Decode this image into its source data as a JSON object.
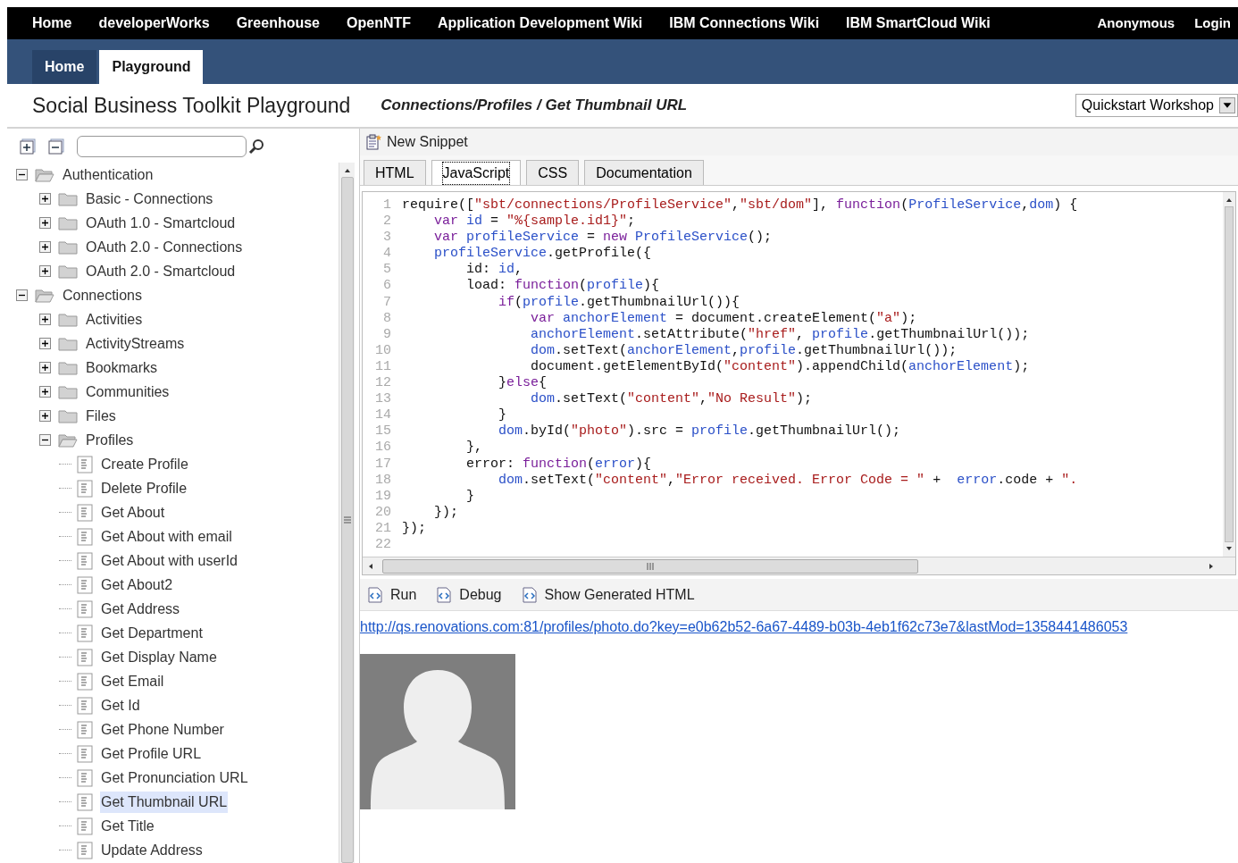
{
  "top_nav": {
    "links": [
      "Home",
      "developerWorks",
      "Greenhouse",
      "OpenNTF",
      "Application Development Wiki",
      "IBM Connections Wiki",
      "IBM SmartCloud Wiki"
    ],
    "user_links": [
      "Anonymous",
      "Login"
    ]
  },
  "main_tabs": [
    {
      "label": "Home",
      "selected": false
    },
    {
      "label": "Playground",
      "selected": true
    }
  ],
  "header": {
    "title": "Social Business Toolkit Playground",
    "breadcrumb": "Connections/Profiles / Get Thumbnail URL",
    "environment": "Quickstart Workshop"
  },
  "sidebar": {
    "tree": [
      {
        "label": "Authentication",
        "kind": "folder",
        "expanded": true,
        "selected": false,
        "children": [
          {
            "label": "Basic - Connections",
            "kind": "folder",
            "expanded": false,
            "selected": false
          },
          {
            "label": "OAuth 1.0 - Smartcloud",
            "kind": "folder",
            "expanded": false,
            "selected": false
          },
          {
            "label": "OAuth 2.0 - Connections",
            "kind": "folder",
            "expanded": false,
            "selected": false
          },
          {
            "label": "OAuth 2.0 - Smartcloud",
            "kind": "folder",
            "expanded": false,
            "selected": false
          }
        ]
      },
      {
        "label": "Connections",
        "kind": "folder",
        "expanded": true,
        "selected": false,
        "children": [
          {
            "label": "Activities",
            "kind": "folder",
            "expanded": false,
            "selected": false
          },
          {
            "label": "ActivityStreams",
            "kind": "folder",
            "expanded": false,
            "selected": false
          },
          {
            "label": "Bookmarks",
            "kind": "folder",
            "expanded": false,
            "selected": false
          },
          {
            "label": "Communities",
            "kind": "folder",
            "expanded": false,
            "selected": false
          },
          {
            "label": "Files",
            "kind": "folder",
            "expanded": false,
            "selected": false
          },
          {
            "label": "Profiles",
            "kind": "folder",
            "expanded": true,
            "selected": false,
            "children": [
              {
                "label": "Create Profile",
                "kind": "document",
                "selected": false
              },
              {
                "label": "Delete Profile",
                "kind": "document",
                "selected": false
              },
              {
                "label": "Get About",
                "kind": "document",
                "selected": false
              },
              {
                "label": "Get About with email",
                "kind": "document",
                "selected": false
              },
              {
                "label": "Get About with userId",
                "kind": "document",
                "selected": false
              },
              {
                "label": "Get About2",
                "kind": "document",
                "selected": false
              },
              {
                "label": "Get Address",
                "kind": "document",
                "selected": false
              },
              {
                "label": "Get Department",
                "kind": "document",
                "selected": false
              },
              {
                "label": "Get Display Name",
                "kind": "document",
                "selected": false
              },
              {
                "label": "Get Email",
                "kind": "document",
                "selected": false
              },
              {
                "label": "Get Id",
                "kind": "document",
                "selected": false
              },
              {
                "label": "Get Phone Number",
                "kind": "document",
                "selected": false
              },
              {
                "label": "Get Profile URL",
                "kind": "document",
                "selected": false
              },
              {
                "label": "Get Pronunciation URL",
                "kind": "document",
                "selected": false
              },
              {
                "label": "Get Thumbnail URL",
                "kind": "document",
                "selected": true
              },
              {
                "label": "Get Title",
                "kind": "document",
                "selected": false
              },
              {
                "label": "Update Address",
                "kind": "document",
                "selected": false
              }
            ]
          }
        ]
      }
    ]
  },
  "editor": {
    "new_snippet": "New Snippet",
    "tabs": [
      {
        "label": "HTML",
        "selected": false
      },
      {
        "label": "JavaScript",
        "selected": true
      },
      {
        "label": "CSS",
        "selected": false
      },
      {
        "label": "Documentation",
        "selected": false
      }
    ],
    "code_lines": [
      {
        "number": "1",
        "tokens": [
          {
            "kind": "plain",
            "text": "require(["
          },
          {
            "kind": "string",
            "text": "\"sbt/connections/ProfileService\""
          },
          {
            "kind": "plain",
            "text": ","
          },
          {
            "kind": "string",
            "text": "\"sbt/dom\""
          },
          {
            "kind": "plain",
            "text": "], "
          },
          {
            "kind": "keyword",
            "text": "function"
          },
          {
            "kind": "plain",
            "text": "("
          },
          {
            "kind": "name",
            "text": "ProfileService"
          },
          {
            "kind": "plain",
            "text": ","
          },
          {
            "kind": "name",
            "text": "dom"
          },
          {
            "kind": "plain",
            "text": ") {"
          }
        ]
      },
      {
        "number": "2",
        "tokens": [
          {
            "kind": "keyword",
            "text": "    var"
          },
          {
            "kind": "name",
            "text": " id"
          },
          {
            "kind": "plain",
            "text": " = "
          },
          {
            "kind": "string",
            "text": "\"%{sample.id1}\""
          },
          {
            "kind": "plain",
            "text": ";"
          }
        ]
      },
      {
        "number": "3",
        "tokens": [
          {
            "kind": "keyword",
            "text": "    var"
          },
          {
            "kind": "name",
            "text": " profileService"
          },
          {
            "kind": "plain",
            "text": " = "
          },
          {
            "kind": "keyword",
            "text": "new"
          },
          {
            "kind": "name",
            "text": " ProfileService"
          },
          {
            "kind": "plain",
            "text": "();"
          }
        ]
      },
      {
        "number": "4",
        "tokens": [
          {
            "kind": "name",
            "text": "    profileService"
          },
          {
            "kind": "plain",
            "text": ".getProfile({"
          }
        ]
      },
      {
        "number": "5",
        "tokens": [
          {
            "kind": "plain",
            "text": "        id: "
          },
          {
            "kind": "name",
            "text": "id"
          },
          {
            "kind": "plain",
            "text": ","
          }
        ]
      },
      {
        "number": "6",
        "tokens": [
          {
            "kind": "plain",
            "text": "        load: "
          },
          {
            "kind": "keyword",
            "text": "function"
          },
          {
            "kind": "plain",
            "text": "("
          },
          {
            "kind": "name",
            "text": "profile"
          },
          {
            "kind": "plain",
            "text": "){"
          }
        ]
      },
      {
        "number": "7",
        "tokens": [
          {
            "kind": "keyword",
            "text": "            if"
          },
          {
            "kind": "plain",
            "text": "("
          },
          {
            "kind": "name",
            "text": "profile"
          },
          {
            "kind": "plain",
            "text": ".getThumbnailUrl()){"
          }
        ]
      },
      {
        "number": "8",
        "tokens": [
          {
            "kind": "keyword",
            "text": "                var"
          },
          {
            "kind": "name",
            "text": " anchorElement"
          },
          {
            "kind": "plain",
            "text": " = document.createElement("
          },
          {
            "kind": "string",
            "text": "\"a\""
          },
          {
            "kind": "plain",
            "text": ");"
          }
        ]
      },
      {
        "number": "9",
        "tokens": [
          {
            "kind": "name",
            "text": "                anchorElement"
          },
          {
            "kind": "plain",
            "text": ".setAttribute("
          },
          {
            "kind": "string",
            "text": "\"href\""
          },
          {
            "kind": "plain",
            "text": ", "
          },
          {
            "kind": "name",
            "text": "profile"
          },
          {
            "kind": "plain",
            "text": ".getThumbnailUrl());"
          }
        ]
      },
      {
        "number": "10",
        "tokens": [
          {
            "kind": "name",
            "text": "                dom"
          },
          {
            "kind": "plain",
            "text": ".setText("
          },
          {
            "kind": "name",
            "text": "anchorElement"
          },
          {
            "kind": "plain",
            "text": ","
          },
          {
            "kind": "name",
            "text": "profile"
          },
          {
            "kind": "plain",
            "text": ".getThumbnailUrl());"
          }
        ]
      },
      {
        "number": "11",
        "tokens": [
          {
            "kind": "plain",
            "text": "                document.getElementById("
          },
          {
            "kind": "string",
            "text": "\"content\""
          },
          {
            "kind": "plain",
            "text": ").appendChild("
          },
          {
            "kind": "name",
            "text": "anchorElement"
          },
          {
            "kind": "plain",
            "text": ");"
          }
        ]
      },
      {
        "number": "12",
        "tokens": [
          {
            "kind": "plain",
            "text": "            }"
          },
          {
            "kind": "keyword",
            "text": "else"
          },
          {
            "kind": "plain",
            "text": "{"
          }
        ]
      },
      {
        "number": "13",
        "tokens": [
          {
            "kind": "name",
            "text": "                dom"
          },
          {
            "kind": "plain",
            "text": ".setText("
          },
          {
            "kind": "string",
            "text": "\"content\""
          },
          {
            "kind": "plain",
            "text": ","
          },
          {
            "kind": "string",
            "text": "\"No Result\""
          },
          {
            "kind": "plain",
            "text": ");"
          }
        ]
      },
      {
        "number": "14",
        "tokens": [
          {
            "kind": "plain",
            "text": "            }"
          }
        ]
      },
      {
        "number": "15",
        "tokens": [
          {
            "kind": "name",
            "text": "            dom"
          },
          {
            "kind": "plain",
            "text": ".byId("
          },
          {
            "kind": "string",
            "text": "\"photo\""
          },
          {
            "kind": "plain",
            "text": ").src = "
          },
          {
            "kind": "name",
            "text": "profile"
          },
          {
            "kind": "plain",
            "text": ".getThumbnailUrl();"
          }
        ]
      },
      {
        "number": "16",
        "tokens": [
          {
            "kind": "plain",
            "text": "        },"
          }
        ]
      },
      {
        "number": "17",
        "tokens": [
          {
            "kind": "plain",
            "text": "        error: "
          },
          {
            "kind": "keyword",
            "text": "function"
          },
          {
            "kind": "plain",
            "text": "("
          },
          {
            "kind": "name",
            "text": "error"
          },
          {
            "kind": "plain",
            "text": "){"
          }
        ]
      },
      {
        "number": "18",
        "tokens": [
          {
            "kind": "name",
            "text": "            dom"
          },
          {
            "kind": "plain",
            "text": ".setText("
          },
          {
            "kind": "string",
            "text": "\"content\""
          },
          {
            "kind": "plain",
            "text": ","
          },
          {
            "kind": "string",
            "text": "\"Error received. Error Code = \""
          },
          {
            "kind": "plain",
            "text": " +  "
          },
          {
            "kind": "name",
            "text": "error"
          },
          {
            "kind": "plain",
            "text": ".code + "
          },
          {
            "kind": "string",
            "text": "\"."
          }
        ]
      },
      {
        "number": "19",
        "tokens": [
          {
            "kind": "plain",
            "text": "        }"
          }
        ]
      },
      {
        "number": "20",
        "tokens": [
          {
            "kind": "plain",
            "text": "    });"
          }
        ]
      },
      {
        "number": "21",
        "tokens": [
          {
            "kind": "plain",
            "text": "});"
          }
        ]
      },
      {
        "number": "22"
      }
    ],
    "actions": [
      "Run",
      "Debug",
      "Show Generated HTML"
    ]
  },
  "result": {
    "link": "http://qs.renovations.com:81/profiles/photo.do?key=e0b62b52-6a67-4489-b03b-4eb1f62c73e7&lastMod=1358441486053"
  }
}
